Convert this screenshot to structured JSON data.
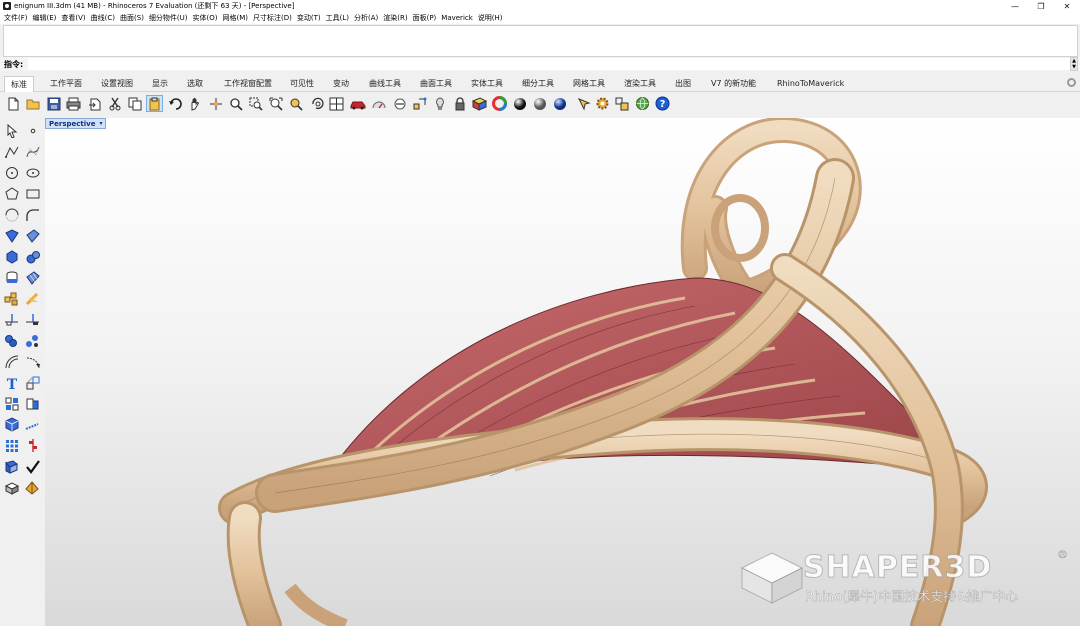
{
  "window": {
    "title": "enignum III.3dm (41 MB) - Rhinoceros 7 Evaluation (还剩下 63 天) - [Perspective]",
    "minimize_glyph": "—",
    "maximize_glyph": "❐",
    "close_glyph": "✕"
  },
  "menu": [
    "文件(F)",
    "编辑(E)",
    "查看(V)",
    "曲线(C)",
    "曲面(S)",
    "细分物件(U)",
    "实体(O)",
    "网格(M)",
    "尺寸标注(D)",
    "变动(T)",
    "工具(L)",
    "分析(A)",
    "渲染(R)",
    "面板(P)",
    "Maverick",
    "说明(H)"
  ],
  "command": {
    "label": "指令:",
    "value": ""
  },
  "tabs": [
    "标准",
    "工作平面",
    "设置视图",
    "显示",
    "选取",
    "工作视窗配置",
    "可见性",
    "变动",
    "曲线工具",
    "曲面工具",
    "实体工具",
    "细分工具",
    "网格工具",
    "渲染工具",
    "出图",
    "V7 的新功能",
    "RhinoToMaverick"
  ],
  "active_tab": "标准",
  "toolbar_icons": [
    "new-file-icon",
    "open-file-icon",
    "save-icon",
    "print-icon",
    "import-icon",
    "cut-icon",
    "copy-icon",
    "paste-icon",
    "undo-icon",
    "pan-icon",
    "rotate-view-icon",
    "zoom-icon",
    "zoom-window-icon",
    "zoom-extents-icon",
    "zoom-selected-icon",
    "undo-view-icon",
    "four-viewports-icon",
    "car-icon",
    "gauge-icon",
    "hide-icon",
    "grid-snap-icon",
    "light-icon",
    "lock-icon",
    "material-icon",
    "color-wheel-icon",
    "shaded-sphere-icon",
    "rendered-sphere-icon",
    "blue-sphere-icon",
    "drafting-icon",
    "settings-gear-icon",
    "transform-icon",
    "globe-icon",
    "help-icon"
  ],
  "sidebar_icons": [
    "select-arrow-icon",
    "point-icon",
    "polyline-icon",
    "curve-icon",
    "circle-icon",
    "ellipse-icon",
    "polygon-icon",
    "rectangle-icon",
    "arc-icon",
    "curve-fillet-icon",
    "surface-icon",
    "surface-edit-icon",
    "box-solid-icon",
    "sphere-solid-icon",
    "cylinder-icon",
    "mesh-icon",
    "explode-icon",
    "split-icon",
    "trim-icon",
    "join-icon",
    "group-icon",
    "analyze-icon",
    "offset-icon",
    "rebuild-icon",
    "text-icon",
    "dimension-icon",
    "array-icon",
    "move-icon",
    "box-icon",
    "measure-icon",
    "grid-array-icon",
    "orient-icon",
    "bend-icon",
    "check-icon",
    "block-icon",
    "render-icon"
  ],
  "viewport": {
    "name": "Perspective",
    "dropdown": "▾"
  },
  "watermark": {
    "title": "SHAPER3D",
    "subtitle": "Rhino(犀牛)中国技术支持&推广中心",
    "reg": "®"
  },
  "colors": {
    "wood": "#e6c9a4",
    "wood_dark": "#b8946a",
    "fabric": "#b85a5e",
    "fabric_dark": "#7a3236",
    "accent": "#1e6bd6"
  }
}
